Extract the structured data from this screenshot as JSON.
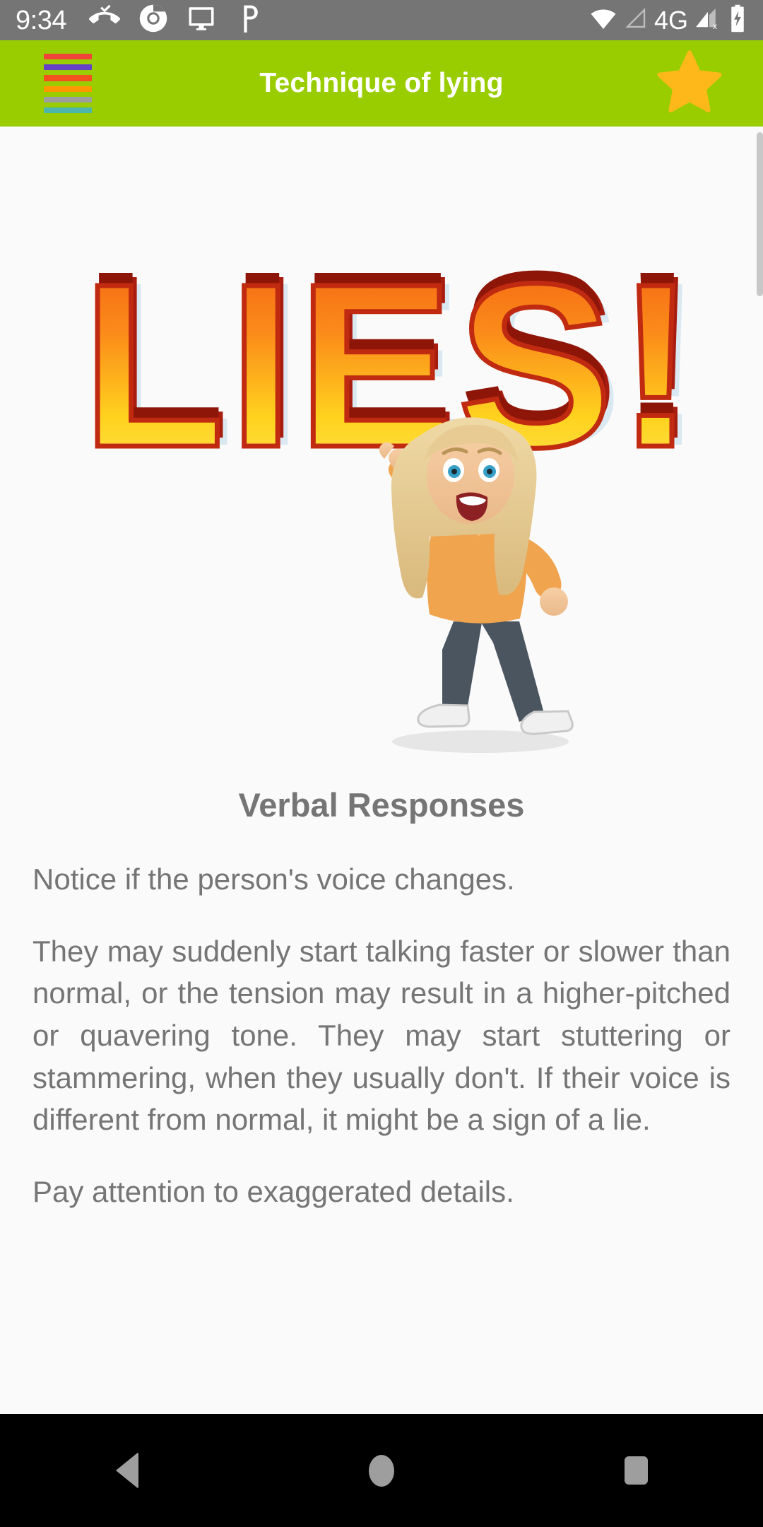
{
  "status_bar": {
    "time": "9:34",
    "left_icons": [
      "missed-call-icon",
      "chrome-icon",
      "cast-screen-icon",
      "pinterest-icon"
    ],
    "right_icons": [
      "wifi-icon",
      "signal-empty-icon",
      "mobile-network-off-icon",
      "battery-charging-icon"
    ],
    "network_label": "4G",
    "background_color": "#757575"
  },
  "app_bar": {
    "title": "Technique of lying",
    "menu_icon": "hamburger-menu-icon",
    "menu_bar_colors": [
      "#f04438",
      "#6441c8",
      "#f4511e",
      "#ff9800",
      "#9e9e9e",
      "#4db6ac"
    ],
    "favorite_icon": "star-icon",
    "favorite_color": "#ffb819",
    "background_color": "#9acd00",
    "title_color": "#ffffff"
  },
  "content": {
    "hero_image": {
      "alt": "lies-illustration",
      "word": "LIES!",
      "character": "bitmoji-pointing-woman"
    },
    "heading": "Verbal Responses",
    "paragraphs": [
      "Notice if the person's voice changes.",
      " They may suddenly start talking faster or slower than normal, or the tension may result in a higher-pitched or quavering tone. They may start stuttering or stammering, when they usually don't. If their voice is different from normal, it might be a sign of a lie.",
      " Pay attention to exaggerated details."
    ],
    "text_color": "#757575",
    "background_color": "#fafafa"
  },
  "nav_bar": {
    "buttons": [
      "back-button",
      "home-button",
      "recent-apps-button"
    ],
    "background_color": "#000000",
    "icon_color": "#9e9e9e"
  }
}
